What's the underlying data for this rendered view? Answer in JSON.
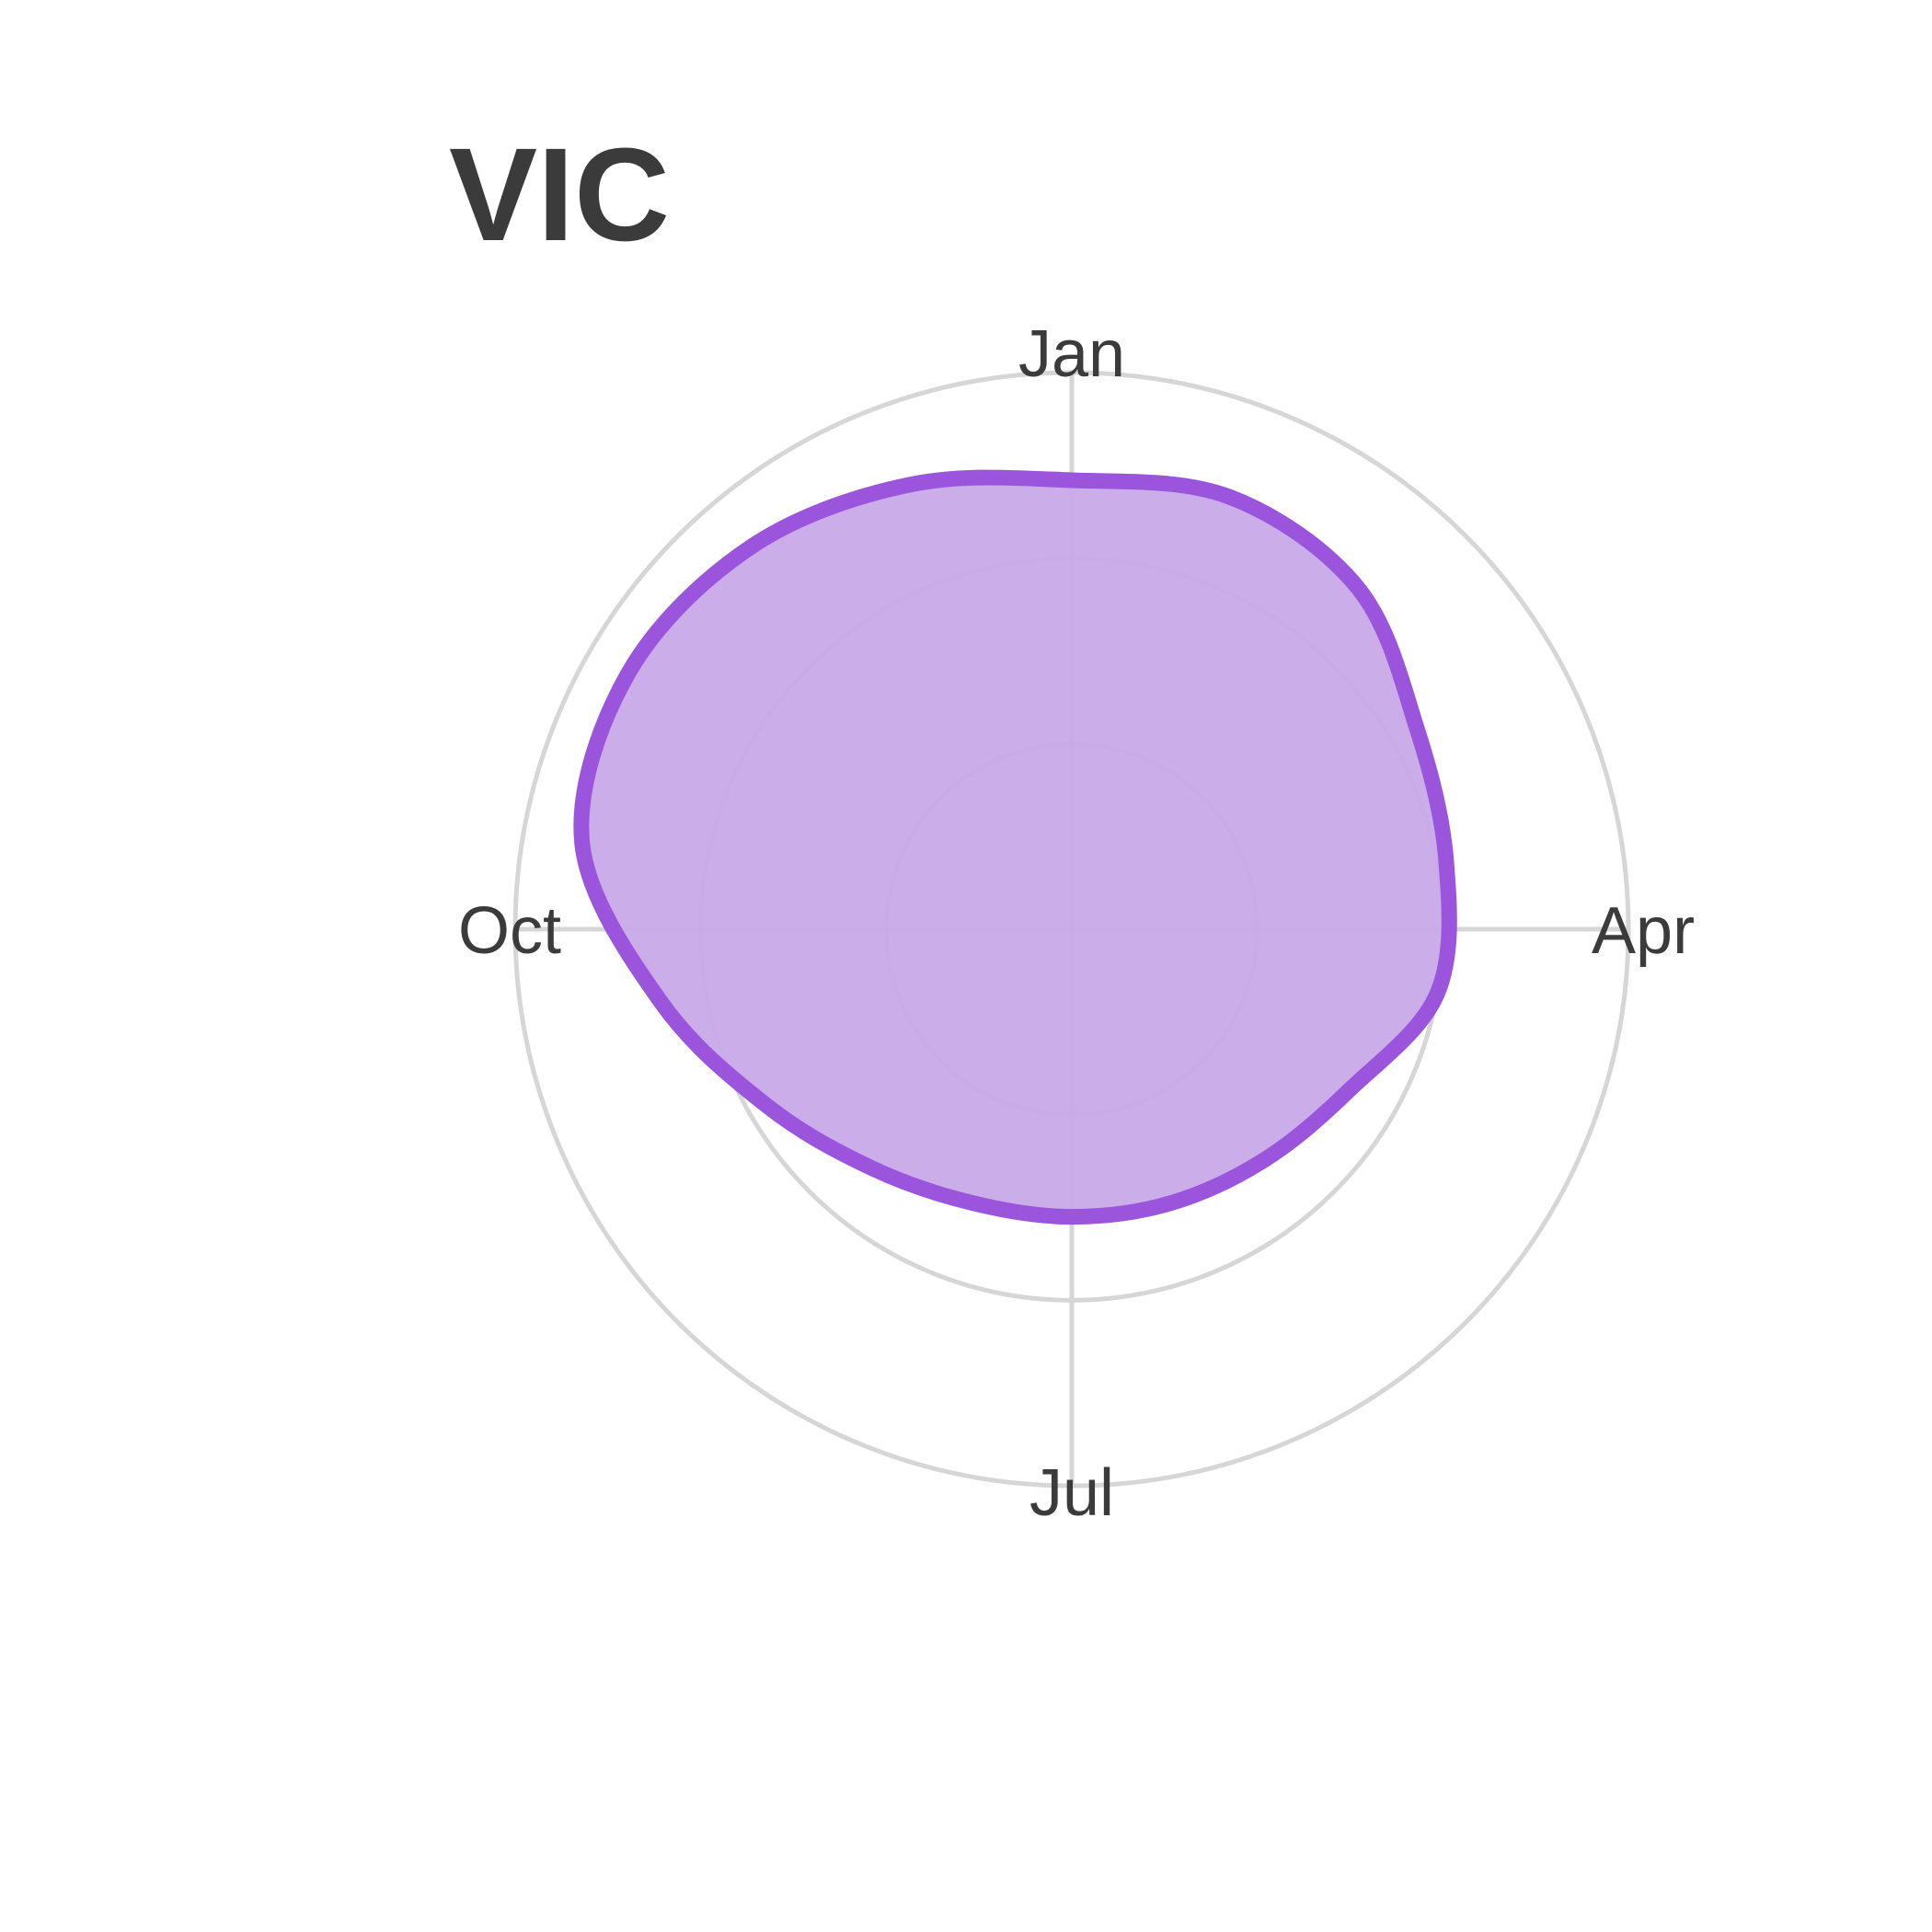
{
  "chart_data": {
    "type": "radar",
    "title": "VIC",
    "categories": [
      "Jan",
      "Apr",
      "Jul",
      "Oct"
    ],
    "angular_labels": [
      "Jan",
      "Apr",
      "Jul",
      "Oct"
    ],
    "radial_range": [
      0,
      3
    ],
    "grid": true,
    "series": [
      {
        "values": [
          2.42,
          2.48,
          2.4,
          2.15,
          2.05,
          2.0,
          1.73,
          1.62,
          1.57,
          1.55,
          1.57,
          1.68,
          1.9,
          2.25,
          2.68,
          2.76,
          2.69,
          2.55
        ]
      }
    ],
    "colors": {
      "fill": "#c8aae8",
      "stroke": "#9b55dc",
      "grid": "#d6d6d6",
      "text": "#3b3b3b"
    }
  }
}
